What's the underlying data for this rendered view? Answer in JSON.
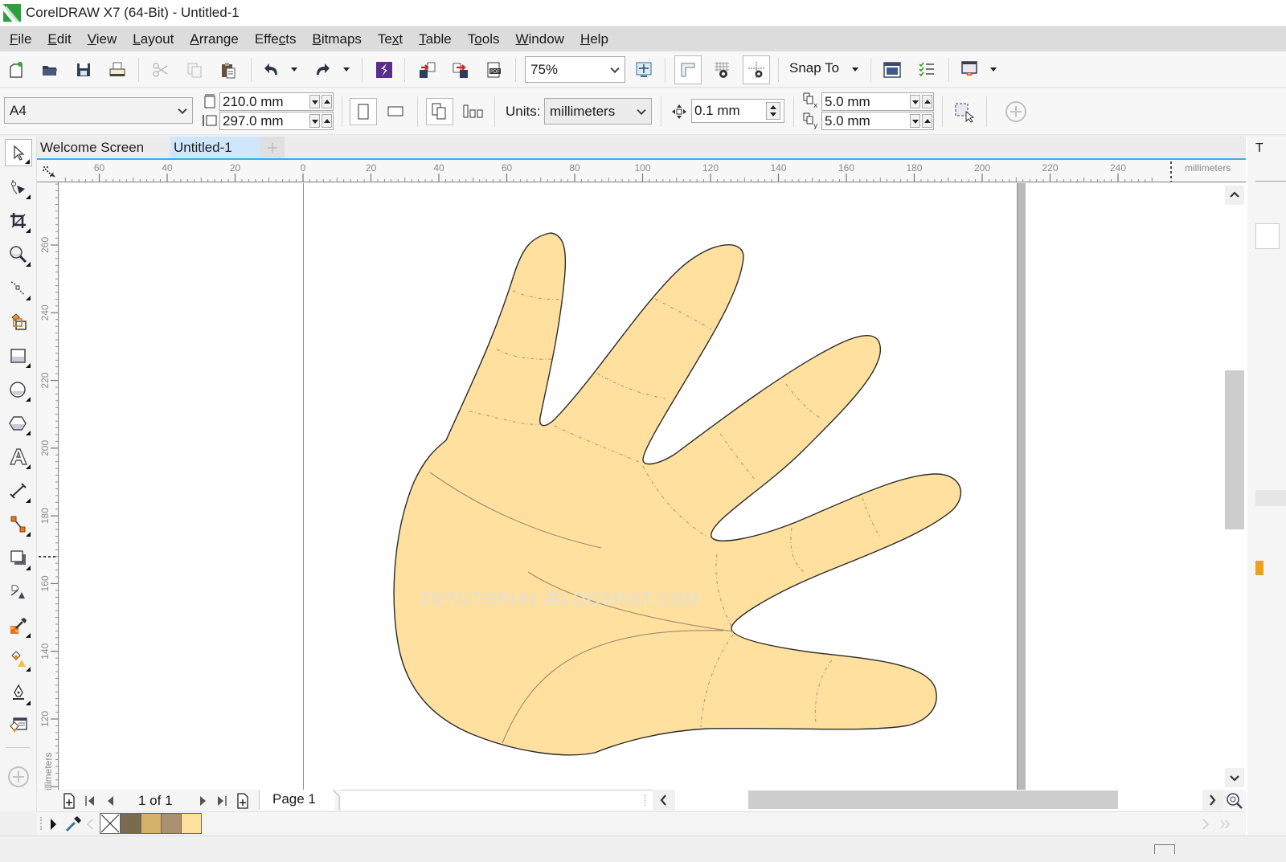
{
  "window": {
    "title": "CorelDRAW X7 (64-Bit) - Untitled-1"
  },
  "menu": [
    {
      "label": "File",
      "u": "F",
      "rest": "ile"
    },
    {
      "label": "Edit",
      "u": "E",
      "rest": "dit"
    },
    {
      "label": "View",
      "u": "V",
      "rest": "iew"
    },
    {
      "label": "Layout",
      "u": "L",
      "rest": "ayout"
    },
    {
      "label": "Arrange",
      "u": "A",
      "rest": "rrange"
    },
    {
      "label": "Effects",
      "pre": "Effe",
      "u": "c",
      "rest": "ts"
    },
    {
      "label": "Bitmaps",
      "u": "B",
      "rest": "itmaps"
    },
    {
      "label": "Text",
      "pre": "Te",
      "u": "x",
      "rest": "t"
    },
    {
      "label": "Table",
      "u": "T",
      "rest": "able"
    },
    {
      "label": "Tools",
      "pre": "T",
      "u": "o",
      "rest": "ols"
    },
    {
      "label": "Window",
      "u": "W",
      "rest": "indow"
    },
    {
      "label": "Help",
      "u": "H",
      "rest": "elp"
    }
  ],
  "toolbar": {
    "zoom_level": "75%",
    "snap_to_label": "Snap To",
    "icons": [
      "new-document-icon",
      "open-icon",
      "save-icon",
      "print-icon",
      "cut-icon",
      "copy-icon",
      "paste-icon",
      "undo-icon",
      "redo-icon",
      "search-content-icon",
      "import-icon",
      "export-icon",
      "publish-pdf-icon",
      "zoom-to-page-icon",
      "rulers-icon",
      "grid-icon",
      "guidelines-icon",
      "app-launcher-icon",
      "options-icon",
      "welcome-screen-icon"
    ]
  },
  "property_bar": {
    "page_size": "A4",
    "page_width": "210.0 mm",
    "page_height": "297.0 mm",
    "units_label": "Units:",
    "units_value": "millimeters",
    "nudge_distance": "0.1 mm",
    "duplicate_x": "5.0 mm",
    "duplicate_y": "5.0 mm"
  },
  "document_tabs": [
    {
      "label": "Welcome Screen",
      "active": false
    },
    {
      "label": "Untitled-1",
      "active": true
    }
  ],
  "ruler": {
    "units": "millimeters",
    "h_labels": [
      "60",
      "40",
      "20",
      "0",
      "20",
      "40",
      "60",
      "80",
      "100",
      "120",
      "140",
      "160",
      "180",
      "200",
      "220",
      "240"
    ],
    "v_labels": [
      "260",
      "240",
      "220",
      "200",
      "180",
      "160",
      "140",
      "120"
    ]
  },
  "canvas": {
    "watermark": "ZOTUTORIAL.BLOGSPOT.COM",
    "hand_fill": "#FFE09E",
    "hand_stroke": "#2b2b2b",
    "line_color": "#a08a6a"
  },
  "page_nav": {
    "page_count": "1 of 1",
    "page_tab": "Page 1"
  },
  "palette": {
    "swatches": [
      "#7a6a4e",
      "#d4b26a",
      "#a89070",
      "#ffe09e"
    ]
  }
}
